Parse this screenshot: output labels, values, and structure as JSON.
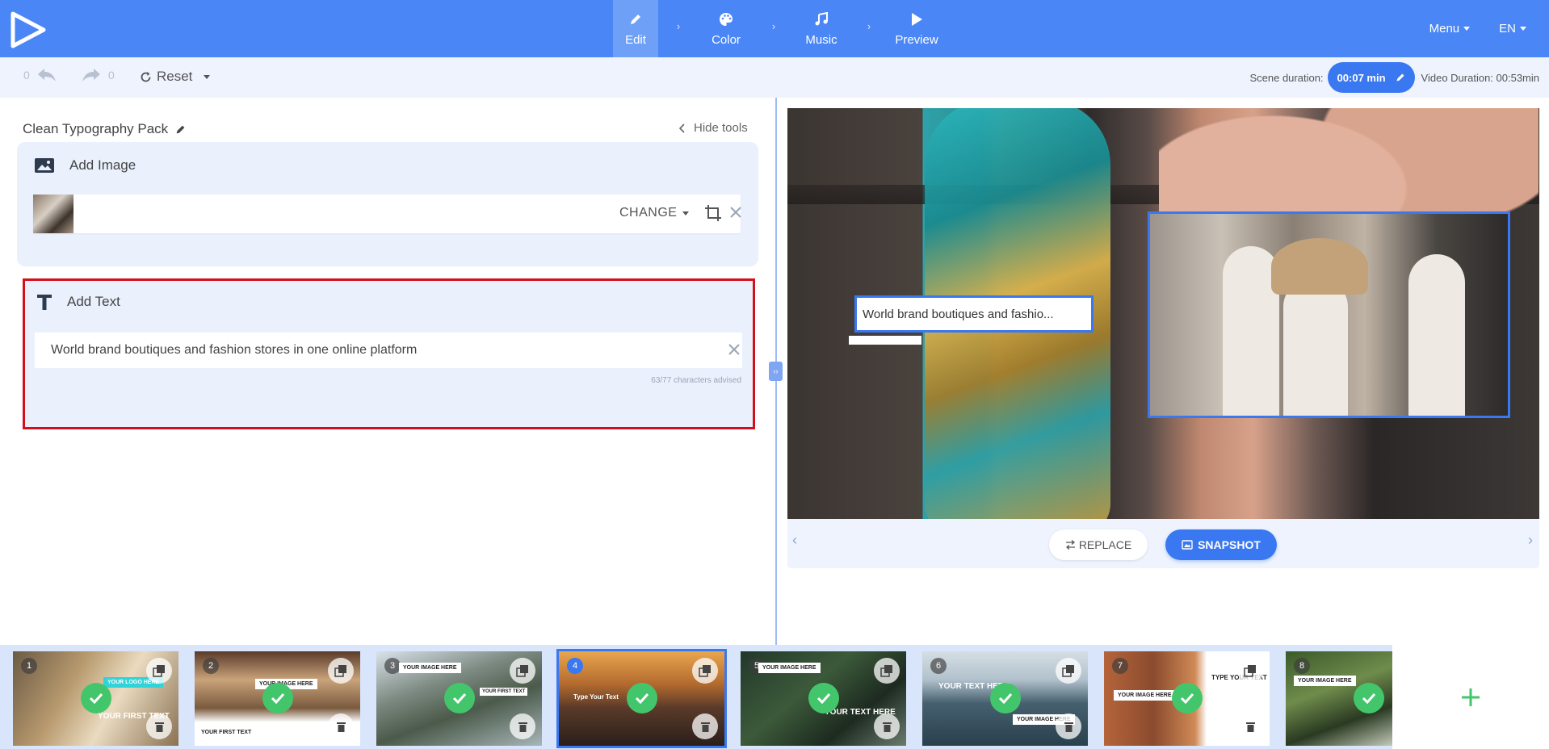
{
  "nav": {
    "steps": [
      {
        "label": "Edit",
        "icon": "pencil-icon",
        "active": true
      },
      {
        "label": "Color",
        "icon": "palette-icon",
        "active": false
      },
      {
        "label": "Music",
        "icon": "music-note-icon",
        "active": false
      },
      {
        "label": "Preview",
        "icon": "play-icon",
        "active": false
      }
    ],
    "separator": "›",
    "menu_label": "Menu",
    "lang_label": "EN"
  },
  "toolbar": {
    "undo_count": "0",
    "redo_count": "0",
    "reset_label": "Reset",
    "scene_duration_label": "Scene duration:",
    "scene_duration_value": "00:07 min",
    "video_duration_label": "Video Duration: 00:53min"
  },
  "editor": {
    "project_title": "Clean Typography Pack",
    "hide_tools_label": "Hide tools",
    "image_card": {
      "heading": "Add Image",
      "change_label": "CHANGE"
    },
    "text_card": {
      "heading": "Add Text",
      "value": "World brand boutiques and fashion stores in one online platform",
      "char_count": "63/77 characters advised"
    }
  },
  "preview": {
    "text_overlay": "World brand boutiques and fashio...",
    "replace_label": "REPLACE",
    "snapshot_label": "SNAPSHOT",
    "prev_arrow": "‹",
    "next_arrow": "›"
  },
  "scenes": [
    {
      "number": "1",
      "active": false,
      "tag": "YOUR LOGO HERE",
      "big": "YOUR FIRST TEXT"
    },
    {
      "number": "2",
      "active": false,
      "tag": "YOUR IMAGE HERE",
      "big": "YOUR FIRST TEXT"
    },
    {
      "number": "3",
      "active": false,
      "tag": "YOUR IMAGE HERE",
      "big": "YOUR FIRST TEXT"
    },
    {
      "number": "4",
      "active": true,
      "tag": "",
      "big": "Type Your Text"
    },
    {
      "number": "5",
      "active": false,
      "tag": "YOUR IMAGE HERE",
      "big": "YOUR TEXT HERE"
    },
    {
      "number": "6",
      "active": false,
      "tag": "YOUR IMAGE HERE",
      "big": "YOUR TEXT HERE"
    },
    {
      "number": "7",
      "active": false,
      "tag": "YOUR IMAGE HERE",
      "big": "TYPE YOUR TEXT"
    },
    {
      "number": "8",
      "active": false,
      "tag": "YOUR IMAGE HERE",
      "big": ""
    }
  ],
  "colors": {
    "brand": "#4a86f5",
    "accent": "#3a78f2",
    "highlight_border": "#d3111d",
    "check_green": "#43c66b"
  }
}
